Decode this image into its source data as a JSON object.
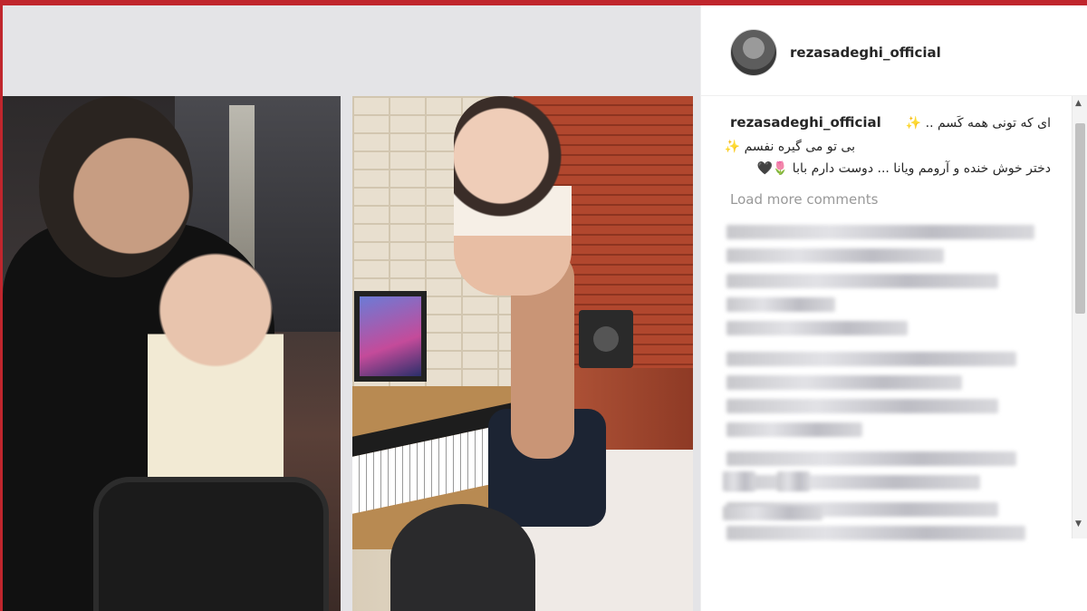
{
  "post": {
    "username": "rezasadeghi_official",
    "caption": {
      "username": "rezasadeghi_official",
      "line1": "ای که تونی همه کَسم .. ✨",
      "line2": "بی تو می گیره نفسم ✨",
      "line3": "دختر خوش خنده و آرومم ویانا ... دوست دارم بابا 🌷🖤"
    },
    "load_more_label": "Load more comments"
  },
  "icons": {
    "avatar": "profile-avatar",
    "scroll_up": "arrow-up-icon",
    "scroll_down": "arrow-down-icon"
  },
  "colors": {
    "border_accent": "#c0262d",
    "text": "#262626",
    "muted": "#999999"
  }
}
